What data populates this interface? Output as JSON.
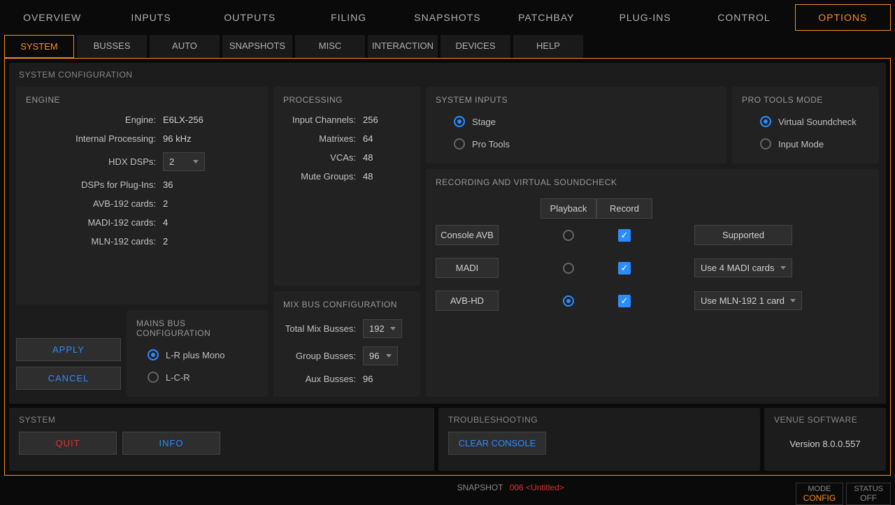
{
  "top_tabs": [
    "OVERVIEW",
    "INPUTS",
    "OUTPUTS",
    "FILING",
    "SNAPSHOTS",
    "PATCHBAY",
    "PLUG-INS",
    "CONTROL",
    "OPTIONS"
  ],
  "top_active": 8,
  "sub_tabs": [
    "SYSTEM",
    "BUSSES",
    "AUTO",
    "SNAPSHOTS",
    "MISC",
    "INTERACTION",
    "DEVICES",
    "HELP"
  ],
  "sub_active": 0,
  "system_config_title": "SYSTEM CONFIGURATION",
  "engine": {
    "title": "ENGINE",
    "rows": {
      "engine_label": "Engine:",
      "engine_val": "E6LX-256",
      "ip_label": "Internal Processing:",
      "ip_val": "96 kHz",
      "hdx_label": "HDX DSPs:",
      "hdx_val": "2",
      "plugin_label": "DSPs for Plug-Ins:",
      "plugin_val": "36",
      "avb_label": "AVB-192 cards:",
      "avb_val": "2",
      "madi_label": "MADI-192 cards:",
      "madi_val": "4",
      "mln_label": "MLN-192 cards:",
      "mln_val": "2"
    }
  },
  "apply": "APPLY",
  "cancel": "CANCEL",
  "mains": {
    "title": "MAINS BUS CONFIGURATION",
    "opt1": "L-R plus Mono",
    "opt2": "L-C-R"
  },
  "processing": {
    "title": "PROCESSING",
    "rows": {
      "ic_label": "Input Channels:",
      "ic_val": "256",
      "mx_label": "Matrixes:",
      "mx_val": "64",
      "vca_label": "VCAs:",
      "vca_val": "48",
      "mg_label": "Mute Groups:",
      "mg_val": "48"
    }
  },
  "mixbus": {
    "title": "MIX BUS CONFIGURATION",
    "total_label": "Total Mix Busses:",
    "total_val": "192",
    "group_label": "Group Busses:",
    "group_val": "96",
    "aux_label": "Aux Busses:",
    "aux_val": "96"
  },
  "sysinputs": {
    "title": "SYSTEM INPUTS",
    "opt1": "Stage",
    "opt2": "Pro Tools"
  },
  "ptmode": {
    "title": "PRO TOOLS MODE",
    "opt1": "Virtual Soundcheck",
    "opt2": "Input Mode"
  },
  "recording": {
    "title": "RECORDING AND VIRTUAL SOUNDCHECK",
    "playback": "Playback",
    "record": "Record",
    "rows": [
      {
        "label": "Console AVB",
        "opt": "Supported",
        "dropdown": false
      },
      {
        "label": "MADI",
        "opt": "Use 4 MADI cards",
        "dropdown": true
      },
      {
        "label": "AVB-HD",
        "opt": "Use MLN-192 1 card",
        "dropdown": true
      }
    ]
  },
  "system": {
    "title": "SYSTEM",
    "quit": "QUIT",
    "info": "INFO"
  },
  "troubleshoot": {
    "title": "TROUBLESHOOTING",
    "clear": "CLEAR CONSOLE"
  },
  "software": {
    "title": "VENUE SOFTWARE",
    "version": "Version 8.0.0.557"
  },
  "status": {
    "snapshot_label": "SNAPSHOT",
    "snapshot_num": "006",
    "snapshot_title": "<Untitled>",
    "mode_label": "MODE",
    "mode_val": "CONFIG",
    "status_label": "STATUS",
    "status_val": "OFF"
  }
}
